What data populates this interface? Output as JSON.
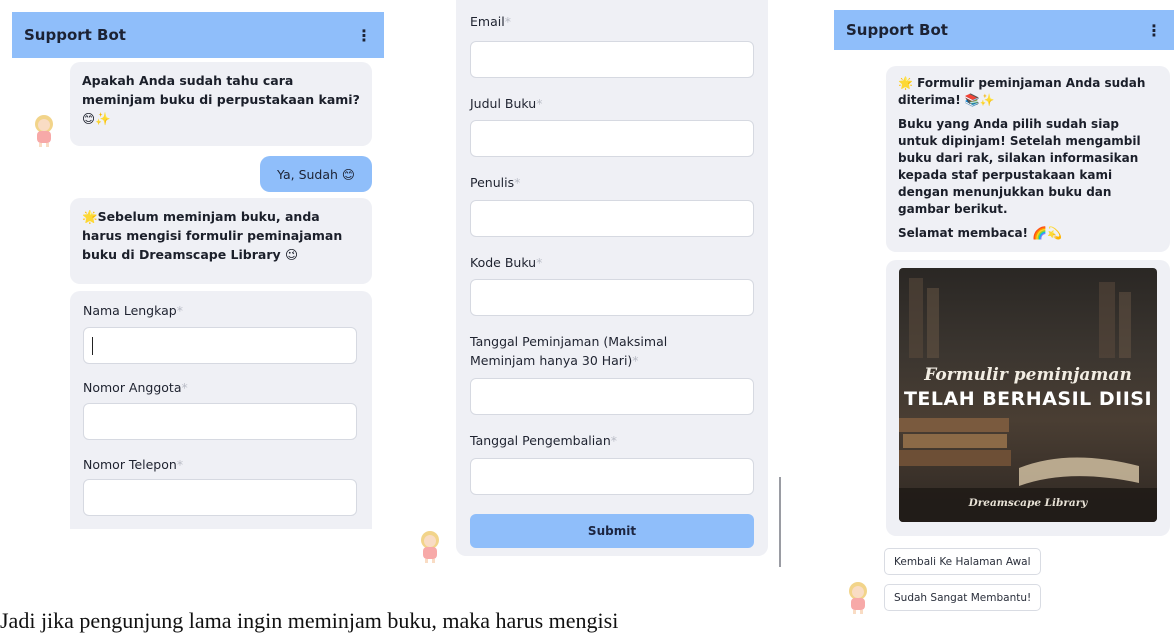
{
  "left_panel": {
    "title": "Support Bot",
    "menu_icon": "⋮",
    "bot_msg_1": "Apakah Anda sudah tahu cara meminjam buku di perpustakaan kami? 😊✨",
    "user_msg": "Ya, Sudah 😊",
    "bot_msg_2": "🌟Sebelum meminjam buku, anda harus mengisi formulir peminajaman buku di Dreamscape Library 😉",
    "fields": [
      {
        "label": "Nama Lengkap",
        "req": "*"
      },
      {
        "label": "Nomor Anggota",
        "req": "*"
      },
      {
        "label": "Nomor Telepon",
        "req": "*"
      }
    ]
  },
  "middle_panel": {
    "fields": [
      {
        "label": "Email",
        "req": "*"
      },
      {
        "label": "Judul Buku",
        "req": "*"
      },
      {
        "label": "Penulis",
        "req": "*"
      },
      {
        "label": "Kode Buku",
        "req": "*"
      },
      {
        "label": "Tanggal Peminjaman (Maksimal Meminjam hanya 30 Hari)",
        "req": "*"
      },
      {
        "label": "Tanggal Pengembalian",
        "req": "*"
      }
    ],
    "submit_label": "Submit"
  },
  "right_panel": {
    "title": "Support Bot",
    "menu_icon": "⋮",
    "confirm_title": "🌟 Formulir peminjaman Anda sudah diterima! 📚✨",
    "confirm_body": "Buku yang Anda pilih sudah siap untuk dipinjam! Setelah mengambil buku dari rak, silakan informasikan kepada staf perpustakaan kami dengan menunjukkan buku dan gambar berikut.",
    "confirm_closing": "Selamat membaca! 🌈💫",
    "image": {
      "script_text": "Formulir peminjaman",
      "bold_text": "TELAH BERHASIL DIISI",
      "footer_text": "Dreamscape Library"
    },
    "quick_replies": [
      "Kembali Ke Halaman Awal",
      "Sudah Sangat Membantu!"
    ]
  },
  "caption": "Jadi jika pengunjung lama ingin meminjam buku, maka harus mengisi",
  "icons": {
    "avatar": "girl-avatar-icon",
    "menu": "kebab-menu-icon"
  },
  "colors": {
    "header": "#8fbefa",
    "bubble": "#eff0f5",
    "submit": "#8fbefa"
  }
}
